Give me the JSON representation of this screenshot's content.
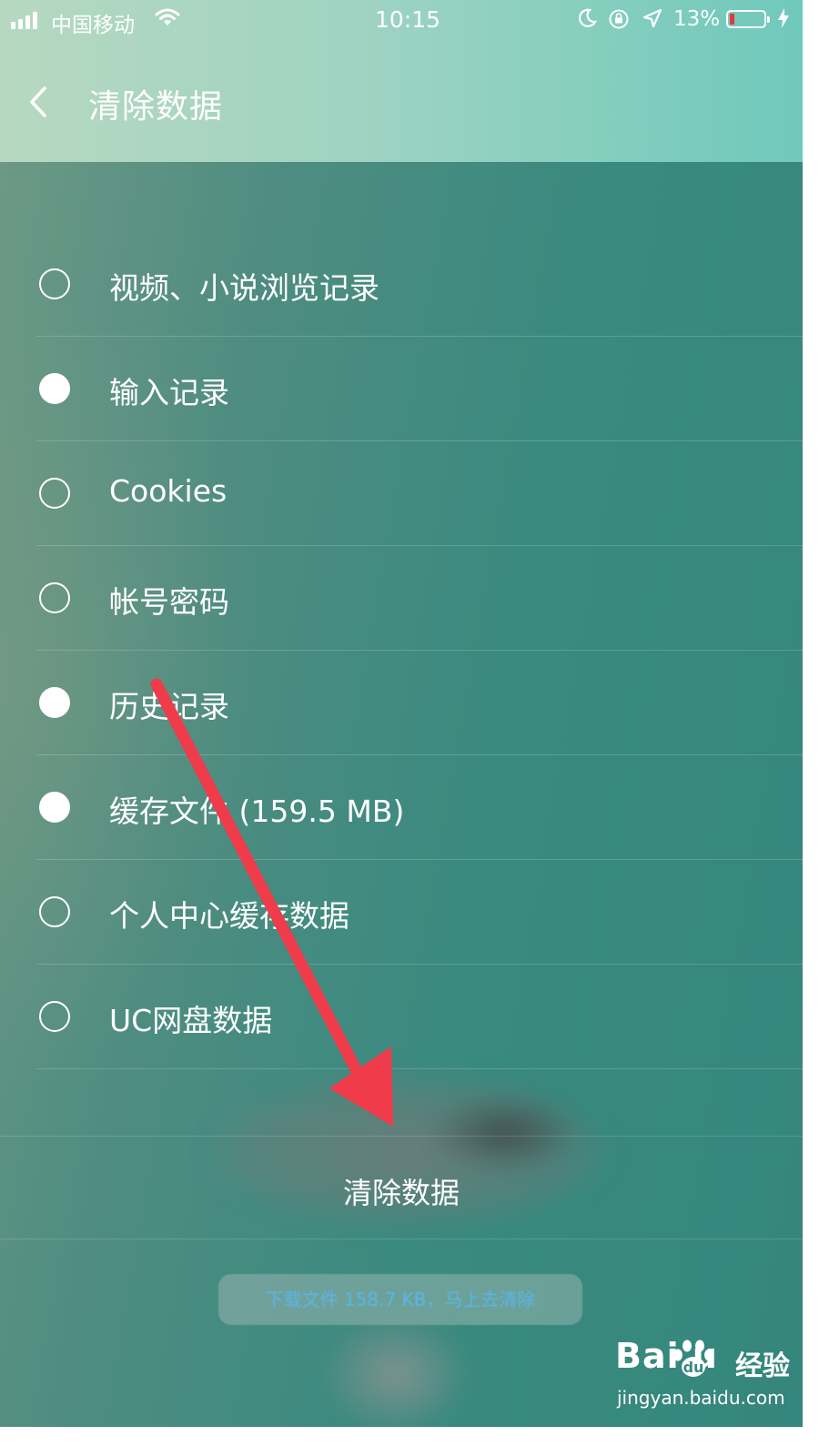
{
  "status_bar": {
    "carrier": "中国移动",
    "time": "10:15",
    "battery_percent": "13%",
    "battery_level": 0.13,
    "battery_color": "#e5383b"
  },
  "header": {
    "title": "清除数据",
    "back_icon": "chevron-left-icon"
  },
  "options": [
    {
      "label": "视频、小说浏览记录",
      "checked": false
    },
    {
      "label": "输入记录",
      "checked": true
    },
    {
      "label": "Cookies",
      "checked": false
    },
    {
      "label": "帐号密码",
      "checked": false
    },
    {
      "label": "历史记录",
      "checked": true
    },
    {
      "label": "缓存文件 (159.5 MB)",
      "checked": true
    },
    {
      "label": "个人中心缓存数据",
      "checked": false
    },
    {
      "label": "UC网盘数据",
      "checked": false
    }
  ],
  "clear_button": {
    "label": "清除数据"
  },
  "download_toast": {
    "text": "下载文件 158.7 KB，马上去清除"
  },
  "annotation": {
    "arrow_color": "#ef3b4a"
  },
  "watermark": {
    "logo": "Bai  u",
    "label": "经验",
    "url": "jingyan.baidu.com"
  },
  "colors": {
    "header_start": "#b6d8c0",
    "header_end": "#6fc9bb",
    "background": "#3a8a7f",
    "text": "#ffffff",
    "toast_text": "#5bb6e8"
  }
}
